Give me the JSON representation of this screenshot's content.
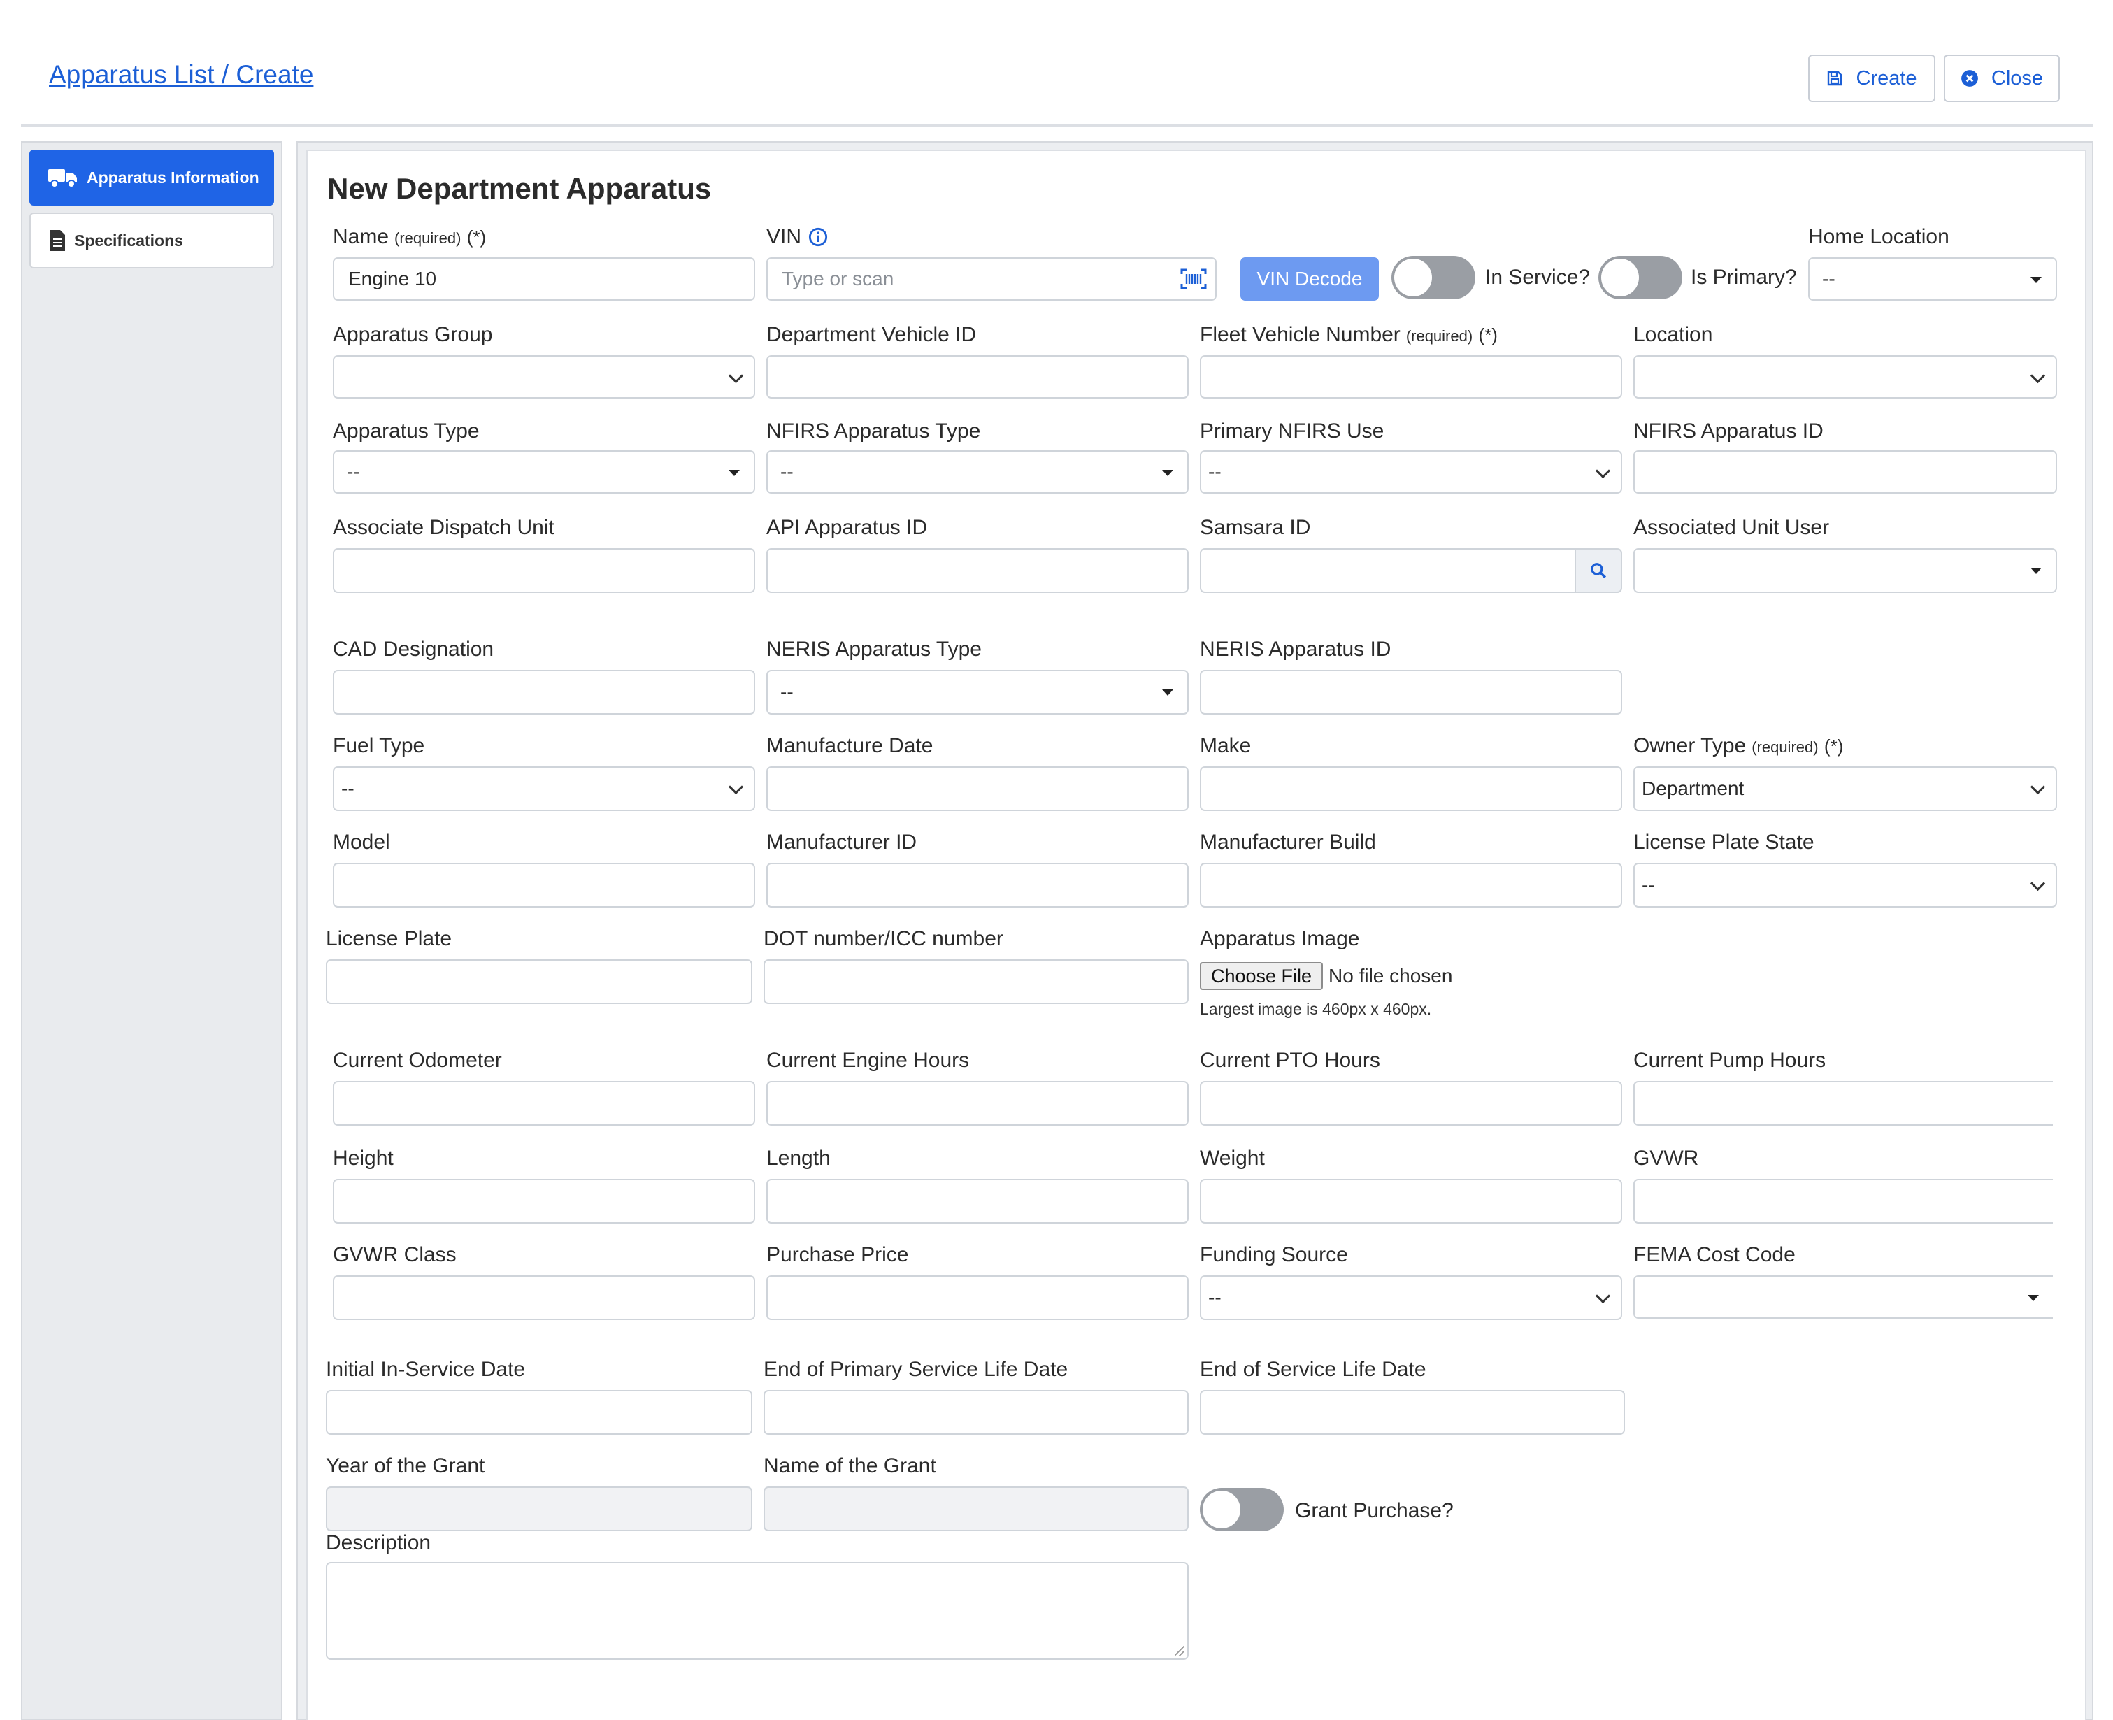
{
  "header": {
    "breadcrumb": "Apparatus List / Create",
    "create_label": "Create",
    "close_label": "Close"
  },
  "sidebar": {
    "items": [
      {
        "label": "Apparatus Information",
        "icon": "truck-icon",
        "active": true
      },
      {
        "label": "Specifications",
        "icon": "document-icon",
        "active": false
      }
    ]
  },
  "form": {
    "title": "New Department Apparatus",
    "required_tag": "(required)",
    "required_mark": "(*)",
    "name": {
      "label": "Name",
      "value": "Engine 10"
    },
    "vin": {
      "label": "VIN",
      "placeholder": "Type or scan",
      "decode_label": "VIN Decode"
    },
    "in_service": {
      "label": "In Service?",
      "on": false
    },
    "is_primary": {
      "label": "Is Primary?",
      "on": false
    },
    "home_location": {
      "label": "Home Location",
      "value": "--"
    },
    "apparatus_group": {
      "label": "Apparatus Group",
      "value": ""
    },
    "department_vehicle_id": {
      "label": "Department Vehicle ID",
      "value": ""
    },
    "fleet_vehicle_number": {
      "label": "Fleet Vehicle Number",
      "value": ""
    },
    "location": {
      "label": "Location",
      "value": ""
    },
    "apparatus_type": {
      "label": "Apparatus Type",
      "value": "--"
    },
    "nfirs_apparatus_type": {
      "label": "NFIRS Apparatus Type",
      "value": "--"
    },
    "primary_nfirs_use": {
      "label": "Primary NFIRS Use",
      "value": "--"
    },
    "nfirs_apparatus_id": {
      "label": "NFIRS Apparatus ID",
      "value": ""
    },
    "associate_dispatch_unit": {
      "label": "Associate Dispatch Unit",
      "value": ""
    },
    "api_apparatus_id": {
      "label": "API Apparatus ID",
      "value": ""
    },
    "samsara_id": {
      "label": "Samsara ID",
      "value": ""
    },
    "associated_unit_user": {
      "label": "Associated Unit User",
      "value": ""
    },
    "cad_designation": {
      "label": "CAD Designation",
      "value": ""
    },
    "neris_apparatus_type": {
      "label": "NERIS Apparatus Type",
      "value": "--"
    },
    "neris_apparatus_id": {
      "label": "NERIS Apparatus ID",
      "value": ""
    },
    "fuel_type": {
      "label": "Fuel Type",
      "value": "--"
    },
    "manufacture_date": {
      "label": "Manufacture Date",
      "value": ""
    },
    "make": {
      "label": "Make",
      "value": ""
    },
    "owner_type": {
      "label": "Owner Type",
      "value": "Department"
    },
    "model": {
      "label": "Model",
      "value": ""
    },
    "manufacturer_id": {
      "label": "Manufacturer ID",
      "value": ""
    },
    "manufacturer_build": {
      "label": "Manufacturer Build",
      "value": ""
    },
    "license_plate_state": {
      "label": "License Plate State",
      "value": "--"
    },
    "license_plate": {
      "label": "License Plate",
      "value": ""
    },
    "dot_number": {
      "label": "DOT number/ICC number",
      "value": ""
    },
    "apparatus_image": {
      "label": "Apparatus Image",
      "button": "Choose File",
      "status": "No file chosen",
      "note": "Largest image is 460px x 460px."
    },
    "current_odometer": {
      "label": "Current Odometer",
      "value": ""
    },
    "current_engine_hours": {
      "label": "Current Engine Hours",
      "value": ""
    },
    "current_pto_hours": {
      "label": "Current PTO Hours",
      "value": ""
    },
    "current_pump_hours": {
      "label": "Current Pump Hours",
      "value": ""
    },
    "height": {
      "label": "Height",
      "value": ""
    },
    "length": {
      "label": "Length",
      "value": ""
    },
    "weight": {
      "label": "Weight",
      "value": ""
    },
    "gvwr": {
      "label": "GVWR",
      "value": ""
    },
    "gvwr_class": {
      "label": "GVWR Class",
      "value": ""
    },
    "purchase_price": {
      "label": "Purchase Price",
      "value": ""
    },
    "funding_source": {
      "label": "Funding Source",
      "value": "--"
    },
    "fema_cost_code": {
      "label": "FEMA Cost Code",
      "value": ""
    },
    "initial_in_service_date": {
      "label": "Initial In-Service Date",
      "value": ""
    },
    "end_primary_service_life": {
      "label": "End of Primary Service Life Date",
      "value": ""
    },
    "end_service_life": {
      "label": "End of Service Life Date",
      "value": ""
    },
    "year_of_grant": {
      "label": "Year of the Grant",
      "value": ""
    },
    "name_of_grant": {
      "label": "Name of the Grant",
      "value": ""
    },
    "grant_purchase": {
      "label": "Grant Purchase?",
      "on": false
    },
    "description": {
      "label": "Description",
      "value": ""
    }
  },
  "colors": {
    "accent": "#1f64e6",
    "link": "#1c5fd6",
    "decode_button": "#6d9af1",
    "toggle_off": "#9a9ea4"
  }
}
